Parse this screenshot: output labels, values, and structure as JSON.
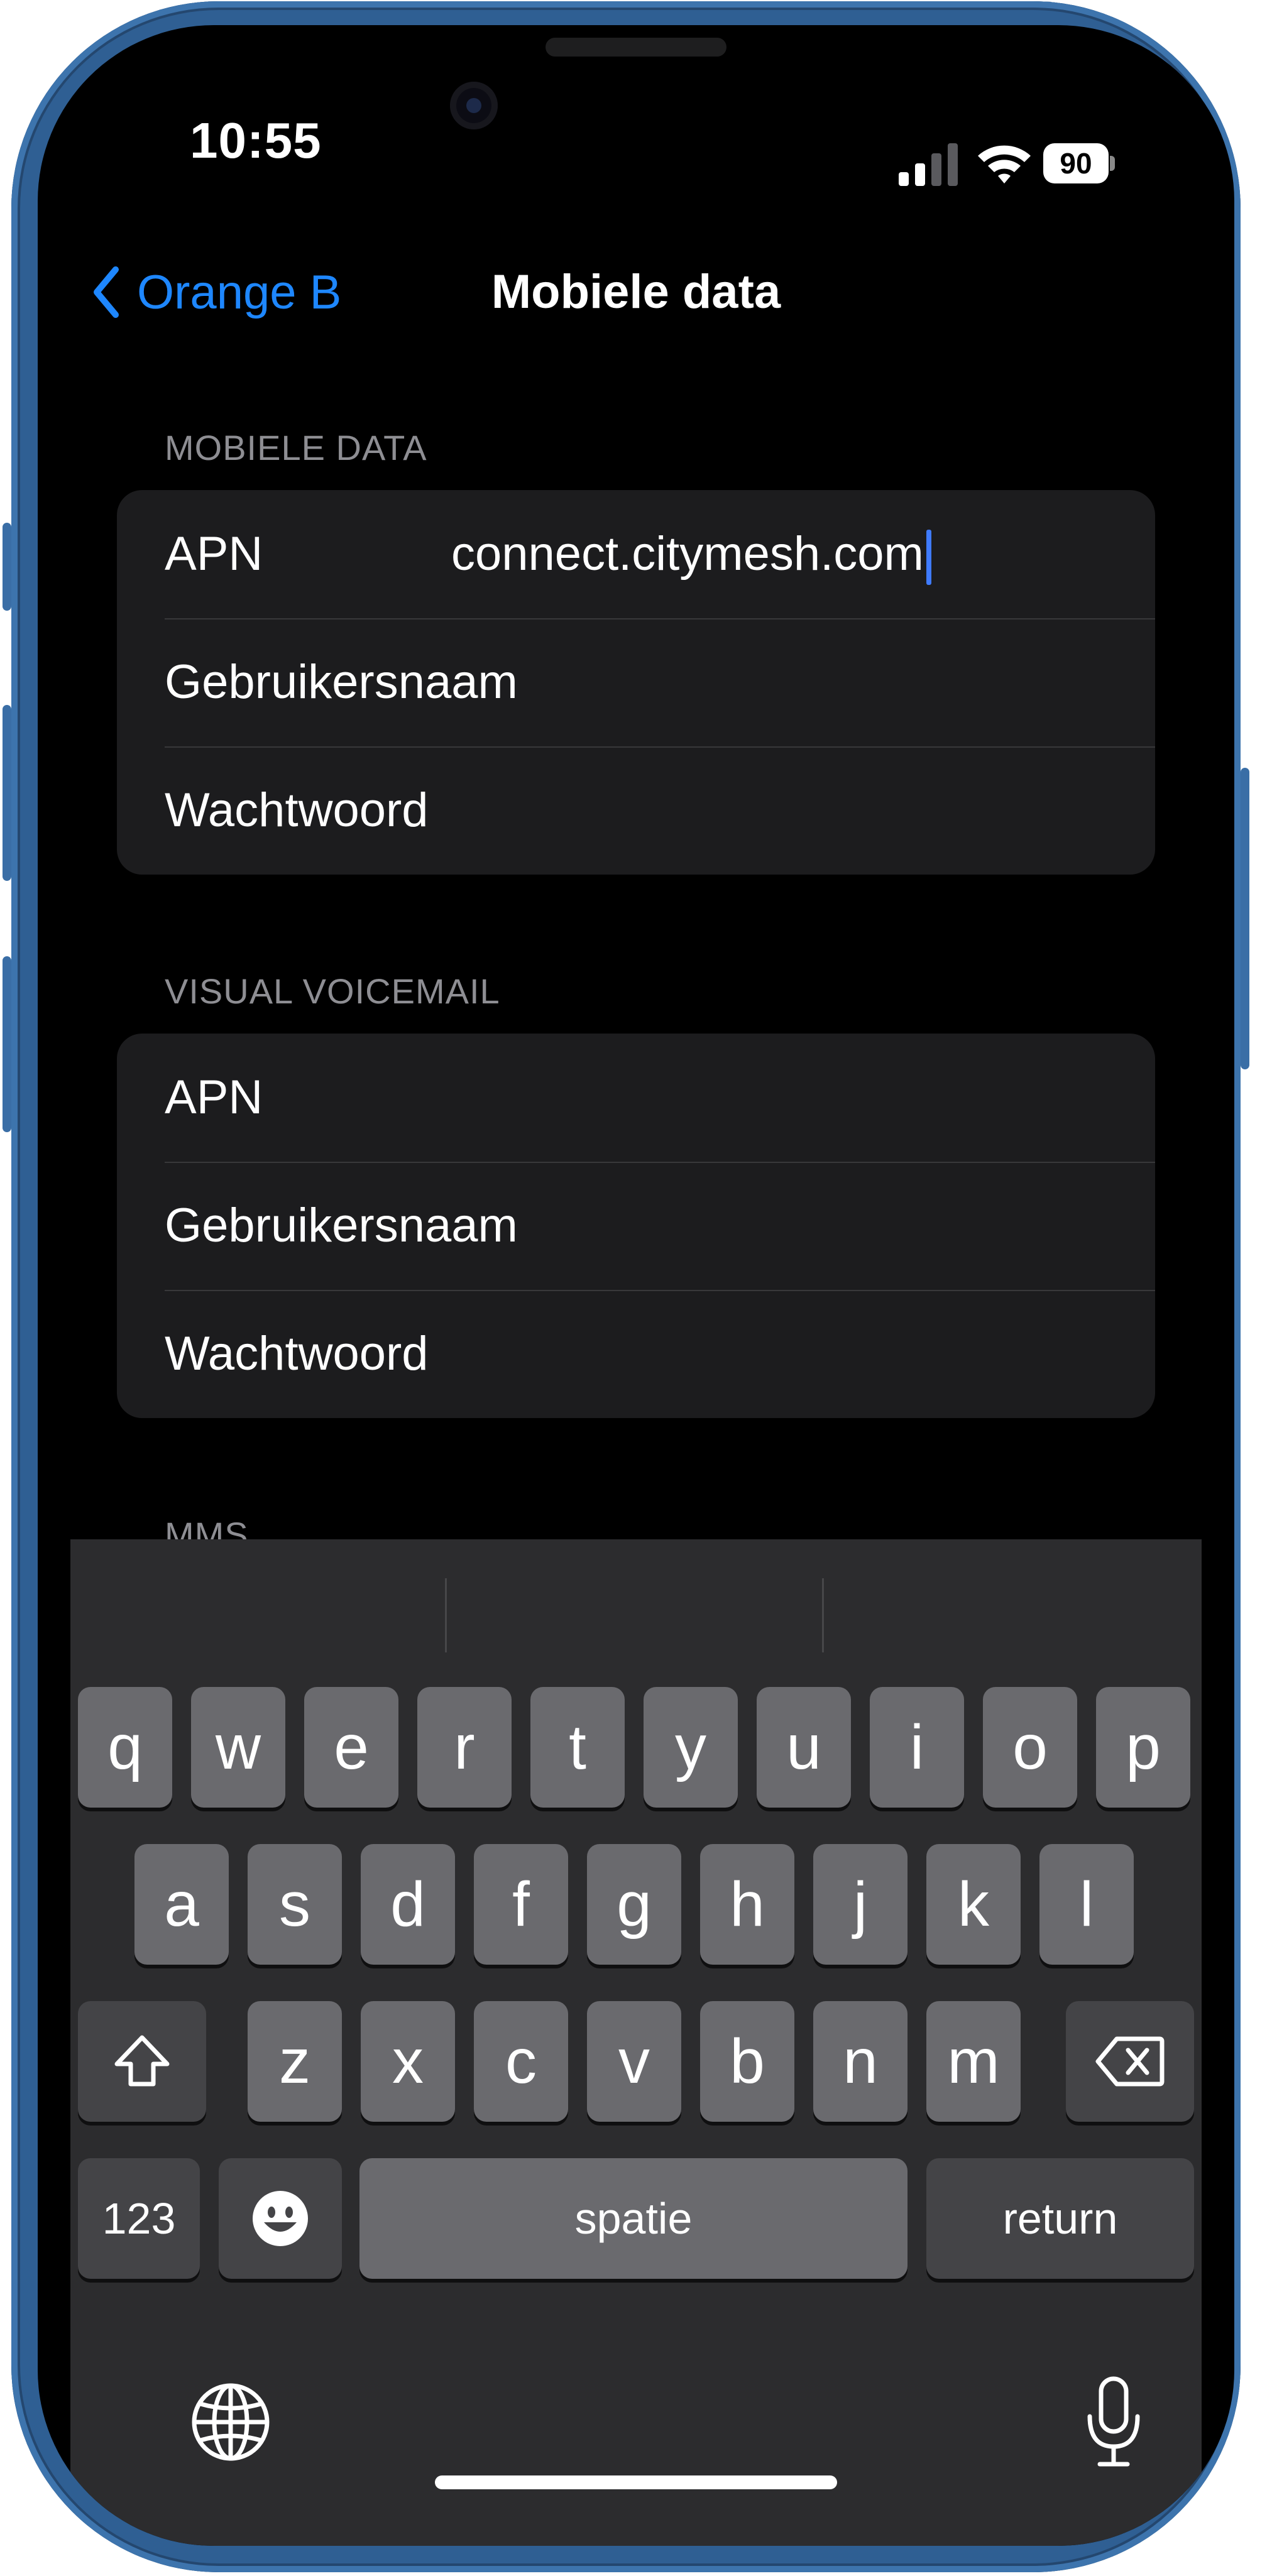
{
  "status_bar": {
    "time": "10:55",
    "battery": "90"
  },
  "nav": {
    "back_label": "Orange B",
    "title": "Mobiele data"
  },
  "sections": [
    {
      "header": "MOBIELE DATA",
      "rows": [
        {
          "label": "APN",
          "value": "connect.citymesh.com"
        },
        {
          "label": "Gebruikersnaam",
          "value": ""
        },
        {
          "label": "Wachtwoord",
          "value": ""
        }
      ]
    },
    {
      "header": "VISUAL VOICEMAIL",
      "rows": [
        {
          "label": "APN",
          "value": ""
        },
        {
          "label": "Gebruikersnaam",
          "value": ""
        },
        {
          "label": "Wachtwoord",
          "value": ""
        }
      ]
    },
    {
      "header": "MMS",
      "rows": []
    }
  ],
  "keyboard": {
    "row1": [
      "q",
      "w",
      "e",
      "r",
      "t",
      "y",
      "u",
      "i",
      "o",
      "p"
    ],
    "row2": [
      "a",
      "s",
      "d",
      "f",
      "g",
      "h",
      "j",
      "k",
      "l"
    ],
    "row3": [
      "z",
      "x",
      "c",
      "v",
      "b",
      "n",
      "m"
    ],
    "numbers_label": "123",
    "space_label": "spatie",
    "return_label": "return"
  },
  "icons": [
    "chevron-left-icon",
    "cellular-signal-icon",
    "wifi-icon",
    "battery-icon",
    "shift-icon",
    "delete-icon",
    "emoji-icon",
    "globe-icon",
    "microphone-icon"
  ]
}
